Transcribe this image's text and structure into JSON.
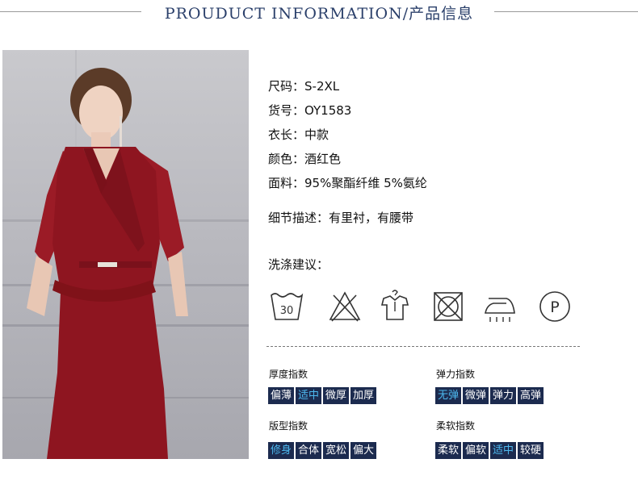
{
  "header": {
    "title": "PROUDUCT INFORMATION/产品信息"
  },
  "specs": [
    {
      "label": "尺码：",
      "value": "S-2XL"
    },
    {
      "label": "货号：",
      "value": "OY1583"
    },
    {
      "label": "衣长：",
      "value": "中款"
    },
    {
      "label": "颜色：",
      "value": "酒红色"
    },
    {
      "label": "面料：",
      "value": "95%聚酯纤维 5%氨纶"
    }
  ],
  "detail": {
    "label": "细节描述：",
    "value": "有里衬，有腰带"
  },
  "care": {
    "title": "洗涤建议：",
    "icons": [
      "wash-30-icon",
      "no-bleach-icon",
      "hang-dry-icon",
      "no-tumble-dry-icon",
      "iron-steam-icon",
      "professional-clean-icon"
    ],
    "wash_temp": "30",
    "dry_clean_letter": "P"
  },
  "indices": {
    "thickness": {
      "label": "厚度指数",
      "options": [
        "偏薄",
        "适中",
        "微厚",
        "加厚"
      ],
      "selected": "适中"
    },
    "elasticity": {
      "label": "弹力指数",
      "options": [
        "无弹",
        "微弹",
        "弹力",
        "高弹"
      ],
      "selected": "无弹"
    },
    "fit": {
      "label": "版型指数",
      "options": [
        "修身",
        "合体",
        "宽松",
        "偏大"
      ],
      "selected": "修身"
    },
    "softness": {
      "label": "柔软指数",
      "options": [
        "柔软",
        "偏软",
        "适中",
        "较硬"
      ],
      "selected": "适中"
    }
  },
  "colors": {
    "chip_bg": "#1c2b4f",
    "chip_text": "#ffffff",
    "chip_selected_text": "#4db8ee",
    "title": "#2a3f6a",
    "dress": "#8e1520"
  }
}
